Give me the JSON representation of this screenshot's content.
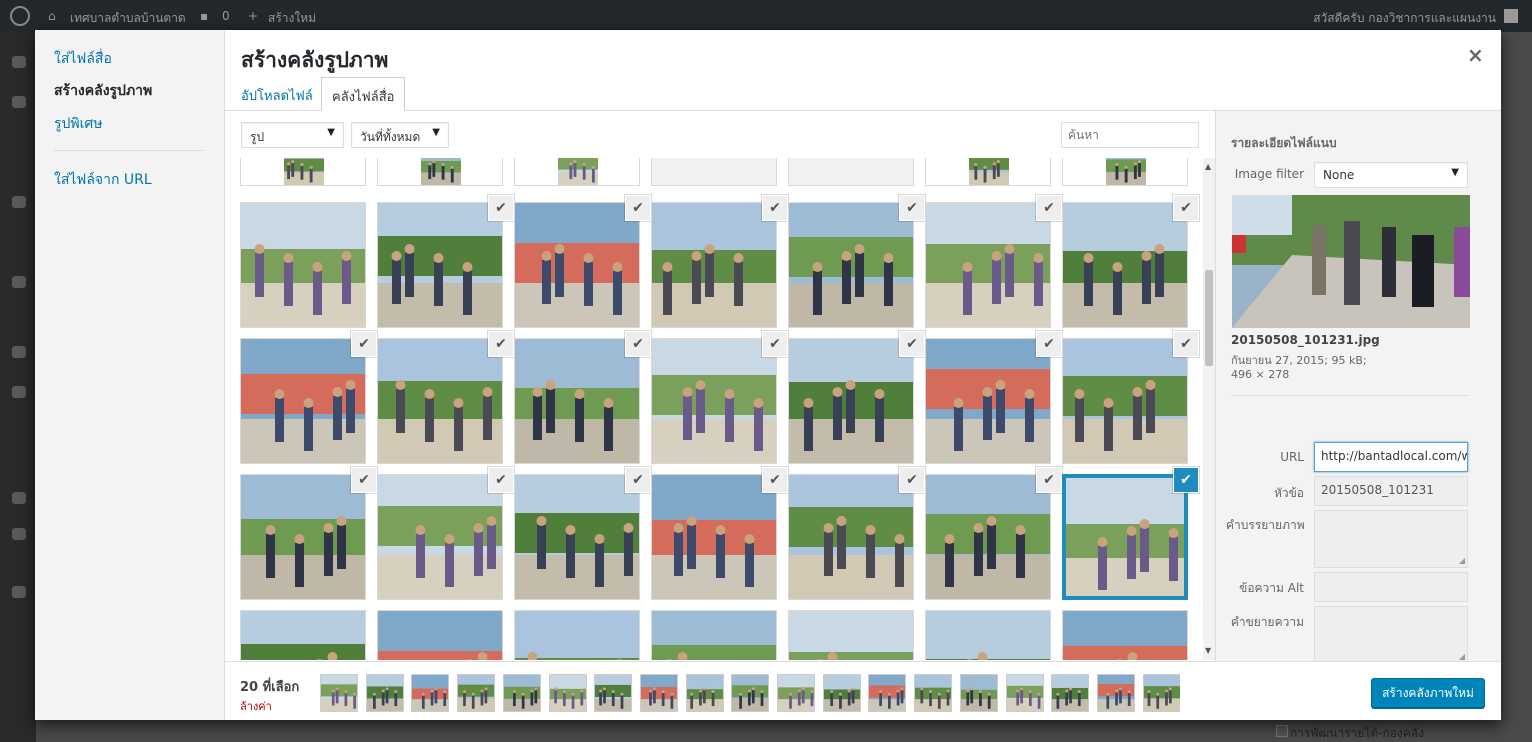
{
  "admin_bar": {
    "site_name": "เทศบาลตำบลบ้านตาด",
    "comments_count": "0",
    "new_label": "สร้างใหม่",
    "greeting": "สวัสดีครับ กองวิชาการและแผนงาน"
  },
  "background": {
    "bottom_item": "การพัฒนารายได้-กองคลัง"
  },
  "modal": {
    "title": "สร้างคลังรูปภาพ",
    "close": "×",
    "menu": [
      {
        "label": "ใส่ไฟล์สื่อ"
      },
      {
        "label": "สร้างคลังรูปภาพ"
      },
      {
        "label": "รูปพิเศษ"
      },
      {
        "label": "ใส่ไฟล์จาก URL"
      }
    ],
    "tabs": [
      {
        "label": "อัปโหลดไฟล์"
      },
      {
        "label": "คลังไฟล์สื่อ"
      }
    ],
    "filters": {
      "type_value": "รูป",
      "date_value": "วันที่ทั้งหมด",
      "search_placeholder": "ค้นหา"
    },
    "details": {
      "heading": "รายละเอียดไฟล์แนบ",
      "image_filter_label": "Image filter",
      "image_filter_value": "None",
      "filename": "20150508_101231.jpg",
      "date_size": "กันยายน 27, 2015;  95 kB;",
      "dimensions": "496 × 278",
      "url_label": "URL",
      "url_value": "http://bantadlocal.com/wp",
      "title_label": "หัวข้อ",
      "title_value": "20150508_101231",
      "caption_label": "คำบรรยายภาพ",
      "alt_label": "ข้อความ Alt",
      "description_label": "คำขยายความ"
    },
    "footer": {
      "selected_count": "20 ที่เลือก",
      "clear_label": "ล้างค่า",
      "primary_button": "สร้างคลังภาพใหม่"
    }
  },
  "icons": {
    "check": "✔",
    "close": "×",
    "select_arrow": "▼"
  }
}
